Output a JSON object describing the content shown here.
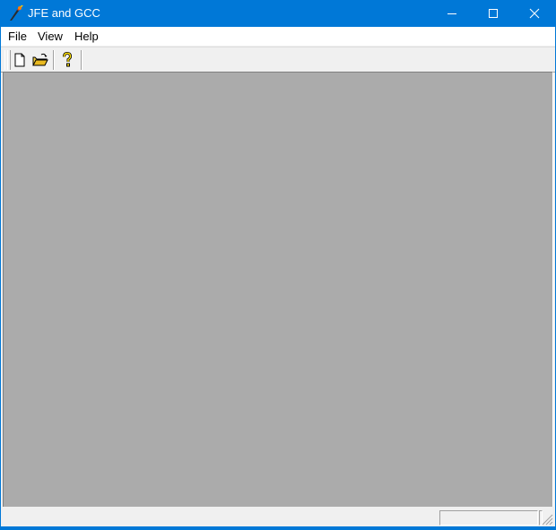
{
  "window": {
    "title": "JFE and GCC",
    "controls": [
      "minimize-icon",
      "maximize-icon",
      "close-icon"
    ]
  },
  "menu": {
    "items": [
      {
        "label": "File"
      },
      {
        "label": "View"
      },
      {
        "label": "Help"
      }
    ]
  },
  "toolbar": {
    "buttons": [
      {
        "icon": "new-document-icon"
      },
      {
        "icon": "open-folder-icon"
      },
      {
        "icon": "help-icon"
      }
    ]
  },
  "statusbar": {
    "main_text": "",
    "side_text": ""
  },
  "colors": {
    "titlebar": "#0078d7",
    "client_area": "#ababab",
    "chrome": "#f0f0f0"
  }
}
